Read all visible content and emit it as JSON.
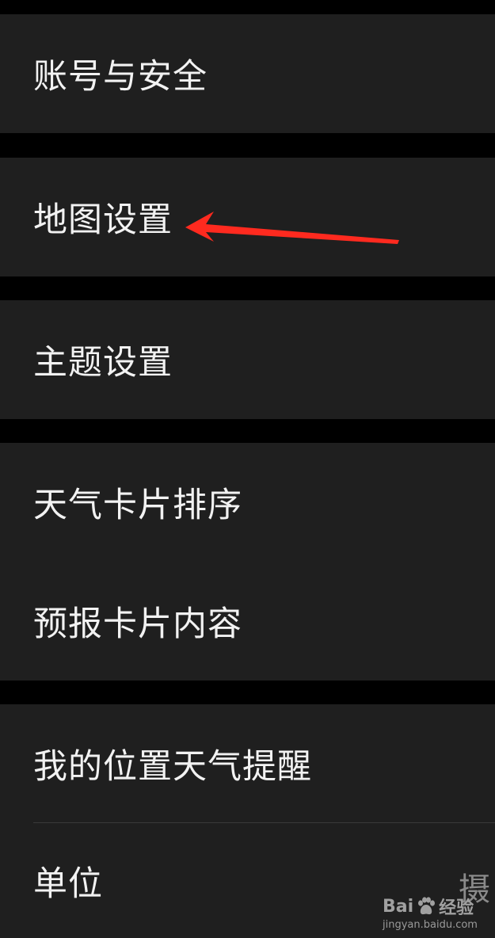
{
  "settings": {
    "items": [
      {
        "label": "账号与安全"
      },
      {
        "label": "地图设置"
      },
      {
        "label": "主题设置"
      },
      {
        "label": "天气卡片排序"
      },
      {
        "label": "预报卡片内容"
      },
      {
        "label": "我的位置天气提醒"
      },
      {
        "label": "单位"
      }
    ]
  },
  "annotation": {
    "arrow_color": "#ff2a1f",
    "points_to": "地图设置"
  },
  "watermark": {
    "char": "摄",
    "brand_left": "Bai",
    "brand_right": "经验",
    "url": "jingyan.baidu.com"
  },
  "colors": {
    "background": "#000000",
    "card": "#1f1f1f",
    "text": "#f2f2f2",
    "divider": "#3a3a3a"
  }
}
